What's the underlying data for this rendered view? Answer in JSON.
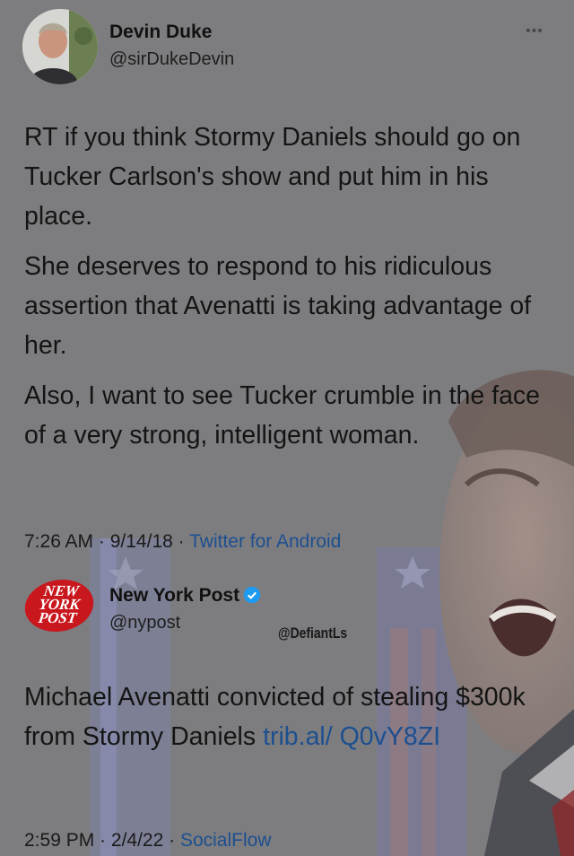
{
  "tweet": {
    "author_name": "Devin Duke",
    "author_handle": "@sirDukeDevin",
    "more_icon": "more-dots-icon",
    "paragraphs": [
      "RT if you think Stormy Daniels should go on Tucker Carlson's show and put him in his place.",
      "She deserves to respond to his ridiculous assertion that Avenatti is taking advantage of her.",
      "Also, I want to see Tucker crumble in the face of a very strong, intelligent woman."
    ],
    "time": "7:26 AM",
    "date": "9/14/18",
    "source": "Twitter for Android"
  },
  "quoted": {
    "logo_lines": [
      "NEW",
      "YORK",
      "POST"
    ],
    "name": "New York Post",
    "verified_icon": "verified-badge-icon",
    "handle": "@nypost",
    "text": "Michael Avenatti convicted of stealing $300k from Stormy Daniels ",
    "link_text": "trib.al/ Q0vY8ZI",
    "time": "2:59 PM",
    "date": "2/4/22",
    "source": "SocialFlow"
  },
  "watermark": "@DefiantLs",
  "separator": " · ",
  "colors": {
    "background": "#7d7d80",
    "link": "#1d4f8f",
    "verified": "#1d9bf0",
    "logo_red": "#c8181e"
  }
}
